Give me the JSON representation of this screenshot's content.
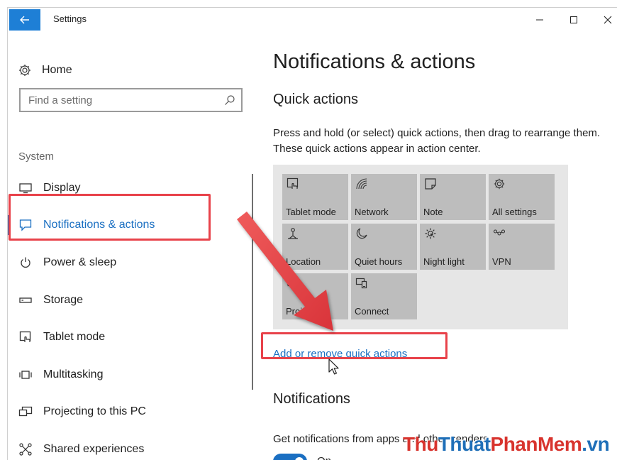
{
  "window": {
    "title": "Settings",
    "controls": {
      "minimize": "—",
      "maximize": "☐",
      "close": "✕"
    }
  },
  "sidebar": {
    "home": "Home",
    "search_placeholder": "Find a setting",
    "group": "System",
    "items": [
      {
        "label": "Display",
        "icon": "display-icon"
      },
      {
        "label": "Notifications & actions",
        "icon": "notifications-icon",
        "active": true
      },
      {
        "label": "Power & sleep",
        "icon": "power-icon"
      },
      {
        "label": "Storage",
        "icon": "storage-icon"
      },
      {
        "label": "Tablet mode",
        "icon": "tablet-mode-icon"
      },
      {
        "label": "Multitasking",
        "icon": "multitasking-icon"
      },
      {
        "label": "Projecting to this PC",
        "icon": "projecting-icon"
      },
      {
        "label": "Shared experiences",
        "icon": "shared-experiences-icon"
      }
    ]
  },
  "main": {
    "title": "Notifications & actions",
    "quick_actions": {
      "heading": "Quick actions",
      "description": "Press and hold (or select) quick actions, then drag to rearrange them. These quick actions appear in action center.",
      "tiles": [
        {
          "label": "Tablet mode",
          "icon": "tablet-mode-icon"
        },
        {
          "label": "Network",
          "icon": "network-icon"
        },
        {
          "label": "Note",
          "icon": "note-icon"
        },
        {
          "label": "All settings",
          "icon": "gear-icon"
        },
        {
          "label": "Location",
          "icon": "location-icon"
        },
        {
          "label": "Quiet hours",
          "icon": "moon-icon"
        },
        {
          "label": "Night light",
          "icon": "sun-icon"
        },
        {
          "label": "VPN",
          "icon": "vpn-icon"
        },
        {
          "label": "Project",
          "icon": "project-icon"
        },
        {
          "label": "Connect",
          "icon": "connect-icon"
        }
      ],
      "link": "Add or remove quick actions"
    },
    "notifications": {
      "heading": "Notifications",
      "setting": "Get notifications from apps and other senders",
      "toggle_state": "On"
    }
  },
  "annotation_color": "#e8424a",
  "accent_color": "#1a6fc2",
  "watermark": {
    "part1": "Thu",
    "part2": "Thuat",
    "part3": "PhanMem",
    "part4": ".vn"
  }
}
